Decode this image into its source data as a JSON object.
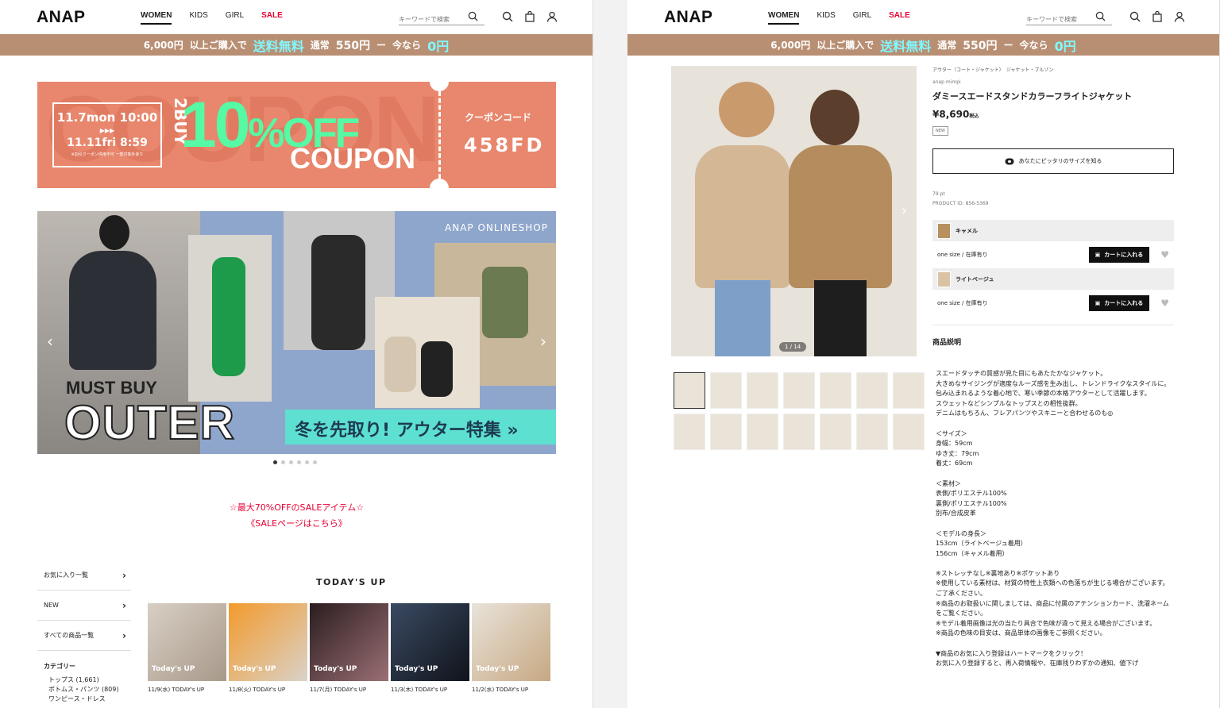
{
  "header": {
    "logo": "ANAP",
    "nav": [
      {
        "label": "WOMEN"
      },
      {
        "label": "KIDS"
      },
      {
        "label": "GIRL"
      },
      {
        "label": "SALE"
      }
    ],
    "search_placeholder": "キーワードで検索"
  },
  "shipbar": {
    "part1": "6,000円",
    "part1b": "以上ご購入で",
    "part2": "送料無料",
    "part3": "通常",
    "part4": "550円",
    "part5": "ー",
    "part6": "今なら",
    "part7": "0円"
  },
  "coupon": {
    "bg_word": "COUPON",
    "date_start": "11.7mon 10:00",
    "arrows": "▶▶▶",
    "date_end": "11.11fri 8:59",
    "note": "※割引クーポン併用不可 一部対象外あり",
    "buy": "2BUY",
    "pct": "10",
    "pct_sym": "%OFF",
    "word": "COUPON",
    "code_title": "クーポンコード",
    "code": "458FD"
  },
  "hero": {
    "brand": "ANAP ONLINESHOP",
    "must": "MUST BUY",
    "outer": "OUTER",
    "feature": "冬を先取り! アウター特集 »",
    "dots": 6
  },
  "sale_link": {
    "line1": "☆最大70%OFFのSALEアイテム☆",
    "line2": "《SALEページはこちら》"
  },
  "sidebar": {
    "items": [
      {
        "label": "お気に入り一覧"
      },
      {
        "label": "NEW"
      },
      {
        "label": "すべての商品一覧"
      }
    ],
    "category_title": "カテゴリー",
    "categories": [
      "トップス (1,661)",
      "ボトムス・パンツ (809)",
      "ワンピース・ドレス"
    ]
  },
  "today": {
    "title": "TODAY'S UP",
    "items": [
      {
        "caption": "11/9(水) TODAY's UP",
        "overlay": "Today's UP"
      },
      {
        "caption": "11/8(火) TODAY's UP",
        "overlay": "Today's UP"
      },
      {
        "caption": "11/7(月) TODAY's UP",
        "overlay": "Today's UP"
      },
      {
        "caption": "11/3(木) TODAY's UP",
        "overlay": "Today's UP"
      },
      {
        "caption": "11/2(水) TODAY's UP",
        "overlay": "Today's UP"
      }
    ]
  },
  "product": {
    "breadcrumb": "アウター（コート・ジャケット）　ジャケット・ブルゾン",
    "brand": "anap mimpi",
    "name": "ダミースエードスタンドカラーフライトジャケット",
    "price": "¥8,690",
    "tax": "税込",
    "badge": "NEW",
    "size_button": "あなたにピッタリのサイズを知る",
    "points": "79 pt",
    "product_id": "PRODUCT ID: 856-5369",
    "gallery_counter": "1 / 14",
    "colors": [
      {
        "name": "キャメル",
        "stock": "one size / 在庫有り",
        "cart": "カートに入れる",
        "swatch": "#b98f60"
      },
      {
        "name": "ライトベージュ",
        "stock": "one size / 在庫有り",
        "cart": "カートに入れる",
        "swatch": "#d9c3a4"
      }
    ],
    "desc_title": "商品説明",
    "description": "スエードタッチの質感が見た目にもあたたかなジャケット。\n大きめなサイジングが適度なルーズ感を生み出し、トレンドライクなスタイルに。\n包み込まれるような着心地で、寒い季節の本格アウターとして活躍します。\nスウェットなどシンプルなトップスとの相性抜群。\nデニムはもちろん、フレアパンツやスキニーと合わせるのも◎\n\n＜サイズ＞\n身幅：59cm\nゆき丈：79cm\n着丈：69cm\n\n＜素材＞\n表側/ポリエステル100%\n裏側/ポリエステル100%\n別布/合成皮革\n\n＜モデルの身長＞\n153cm（ライトベージュ着用）\n156cm（キャメル着用）\n\n※ストレッチなし※裏地あり※ポケットあり\n※使用している素材は、材質の特性上衣類への色落ちが生じる場合がございます。ご了承ください。\n※商品のお取扱いに関しましては、商品に付属のアテンションカード、洗濯ネームをご覧ください。\n※モデル着用画像は光の当たり具合で色味が違って見える場合がございます。\n※商品の色味の目安は、商品単体の画像をご参照ください。\n\n▼商品のお気に入り登録はハートマークをクリック！\nお気に入り登録すると、再入荷情報や、在庫残りわずかの通知、値下げ"
  },
  "colors": {
    "shipbar": "#b98f74",
    "coupon": "#e8876d",
    "accent_green": "#56f9a4",
    "sale_red": "#e60033"
  }
}
